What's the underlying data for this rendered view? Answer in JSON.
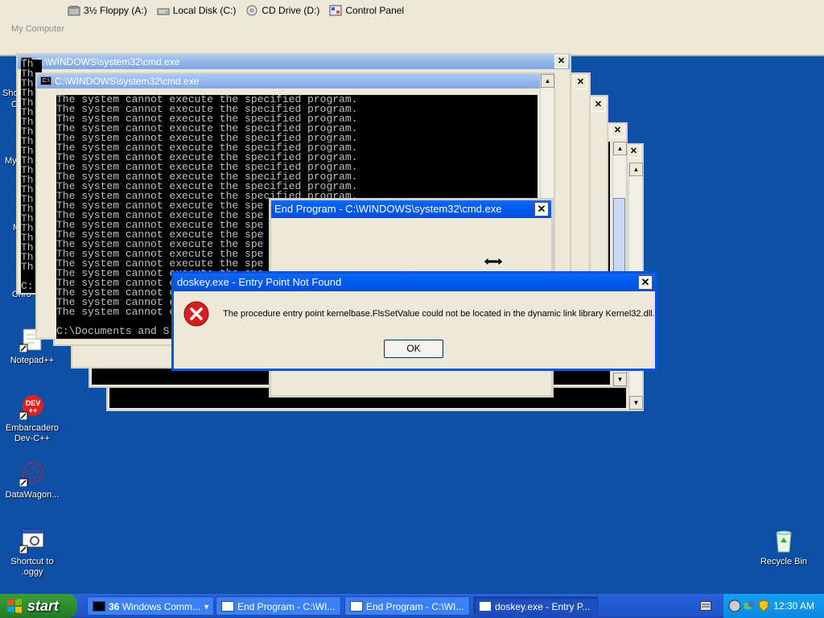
{
  "explorer": {
    "drives": [
      "3½ Floppy (A:)",
      "Local Disk (C:)",
      "CD Drive (D:)",
      "Control Panel"
    ],
    "location": "My Computer"
  },
  "desktop": {
    "left_fragments": [
      "Sho",
      "C",
      "My",
      "M",
      "Chro"
    ],
    "icons": [
      {
        "label": "Notepad++"
      },
      {
        "label": "Embarcadero Dev-C++"
      },
      {
        "label": "DataWagon..."
      },
      {
        "label": "Shortcut to .oggy"
      },
      {
        "label": "Recycle Bin"
      }
    ]
  },
  "cmd": {
    "back_title": "C:\\WINDOWS\\system32\\cmd.exe",
    "front_title": "C:\\WINDOWS\\system32\\cmd.exe",
    "icon_text": "C:\\",
    "left_column": "Th",
    "error_line": "The system cannot execute the specified program.",
    "truncated_line": "The system cannot execute the spe",
    "prompt_back": "C:",
    "prompt_front": "C:\\Documents and S"
  },
  "end_program": {
    "title": "End Program - C:\\WINDOWS\\system32\\cmd.exe"
  },
  "error_dialog": {
    "title": "doskey.exe - Entry Point Not Found",
    "message": "The procedure entry point kernelbase.FlsSetValue could not be located in the dynamic link library Kernel32.dll.",
    "ok_label": "OK"
  },
  "taskbar": {
    "start_label": "start",
    "tasks": [
      {
        "count": "36",
        "label": "Windows Comm..."
      },
      {
        "label": "End Program - C:\\WI..."
      },
      {
        "label": "End Program - C:\\WI..."
      },
      {
        "label": "doskey.exe - Entry P..."
      }
    ],
    "clock": "12:30 AM"
  },
  "colors": {
    "desktop": "#0d4fa6",
    "title_active": "#0054e3",
    "error_icon": "#d42020"
  }
}
